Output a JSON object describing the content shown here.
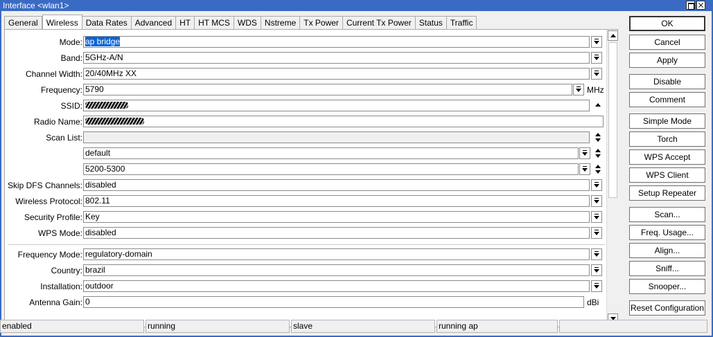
{
  "window": {
    "title": "Interface <wlan1>"
  },
  "tabs": [
    "General",
    "Wireless",
    "Data Rates",
    "Advanced",
    "HT",
    "HT MCS",
    "WDS",
    "Nstreme",
    "Tx Power",
    "Current Tx Power",
    "Status",
    "Traffic"
  ],
  "active_tab": "Wireless",
  "form": {
    "mode": {
      "label": "Mode:",
      "value": "ap bridge"
    },
    "band": {
      "label": "Band:",
      "value": "5GHz-A/N"
    },
    "channel_width": {
      "label": "Channel Width:",
      "value": "20/40MHz XX"
    },
    "frequency": {
      "label": "Frequency:",
      "value": "5790",
      "unit": "MHz"
    },
    "ssid": {
      "label": "SSID:"
    },
    "radio_name": {
      "label": "Radio Name:"
    },
    "scan_list": {
      "label": "Scan List:",
      "value": "",
      "items": [
        "default",
        "5200-5300"
      ]
    },
    "skip_dfs": {
      "label": "Skip DFS Channels:",
      "value": "disabled"
    },
    "wireless_protocol": {
      "label": "Wireless Protocol:",
      "value": "802.11"
    },
    "security_profile": {
      "label": "Security Profile:",
      "value": "Key"
    },
    "wps_mode": {
      "label": "WPS Mode:",
      "value": "disabled"
    },
    "frequency_mode": {
      "label": "Frequency Mode:",
      "value": "regulatory-domain"
    },
    "country": {
      "label": "Country:",
      "value": "brazil"
    },
    "installation": {
      "label": "Installation:",
      "value": "outdoor"
    },
    "antenna_gain": {
      "label": "Antenna Gain:",
      "value": "0",
      "unit": "dBi"
    }
  },
  "buttons": {
    "ok": "OK",
    "cancel": "Cancel",
    "apply": "Apply",
    "disable": "Disable",
    "comment": "Comment",
    "simple_mode": "Simple Mode",
    "torch": "Torch",
    "wps_accept": "WPS Accept",
    "wps_client": "WPS Client",
    "setup_repeater": "Setup Repeater",
    "scan": "Scan...",
    "freq_usage": "Freq. Usage...",
    "align": "Align...",
    "sniff": "Sniff...",
    "snooper": "Snooper...",
    "reset_configuration": "Reset Configuration"
  },
  "status": [
    "enabled",
    "running",
    "slave",
    "running ap",
    ""
  ],
  "colors": {
    "titlebar": "#3a6bc4",
    "selection": "#0a64d6"
  }
}
